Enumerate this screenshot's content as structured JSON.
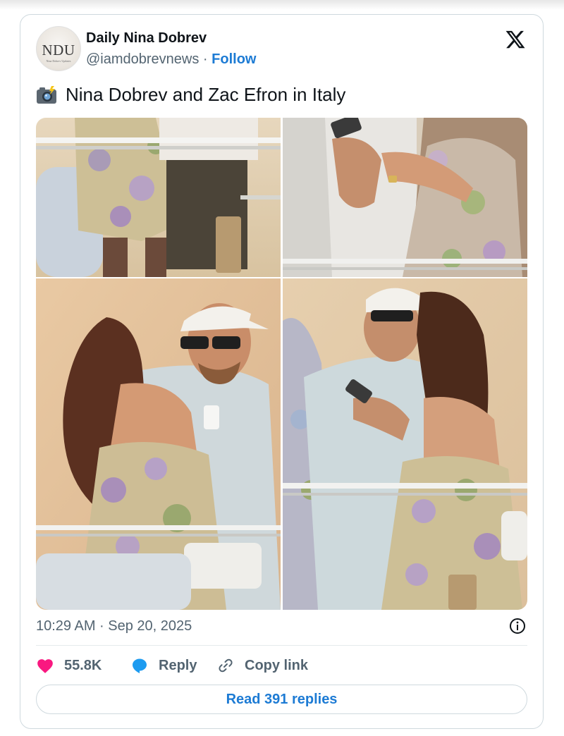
{
  "account": {
    "avatar_monogram": "NDU",
    "avatar_tagline": "Nina Dobrev Updates",
    "display_name": "Daily Nina Dobrev",
    "handle": "@iamdobrevnews",
    "separator": " · ",
    "follow_label": "Follow"
  },
  "tweet": {
    "emoji_icon": "camera-with-flash-icon",
    "text": "Nina Dobrev and Zac Efron in Italy",
    "timestamp": "10:29 AM · Sep 20, 2025"
  },
  "media": {
    "photo_count": 4
  },
  "actions": {
    "like_count": "55.8K",
    "reply_label": "Reply",
    "copy_label": "Copy link"
  },
  "read_replies_label": "Read 391 replies",
  "colors": {
    "accent": "#1d7bd4",
    "like": "#f91880",
    "muted_text": "#536471",
    "border": "#cfd9de"
  }
}
